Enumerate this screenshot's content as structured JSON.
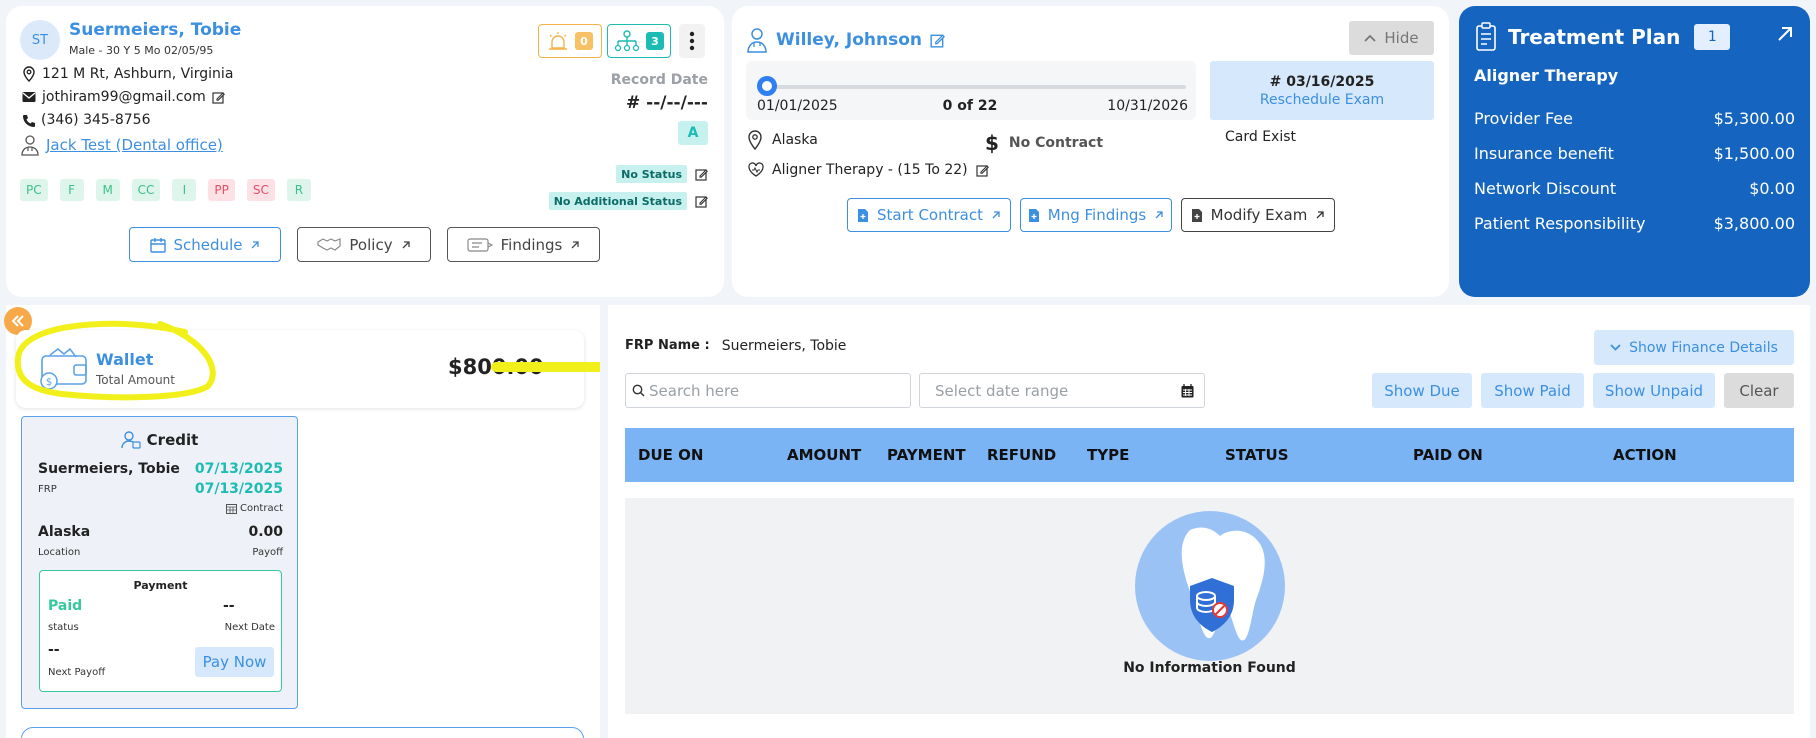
{
  "patient": {
    "initials": "ST",
    "name": "Suermeiers, Tobie",
    "meta": "Male - 30 Y 5 Mo 02/05/95",
    "address": "121 M Rt, Ashburn, Virginia",
    "email": "jothiram99@gmail.com",
    "phone": "(346) 345-8756",
    "office": "Jack Test (Dental office)",
    "tags": [
      {
        "label": "PC",
        "color": "green"
      },
      {
        "label": "F",
        "color": "green"
      },
      {
        "label": "M",
        "color": "green"
      },
      {
        "label": "CC",
        "color": "green"
      },
      {
        "label": "I",
        "color": "green"
      },
      {
        "label": "PP",
        "color": "red"
      },
      {
        "label": "SC",
        "color": "red"
      },
      {
        "label": "R",
        "color": "green"
      }
    ],
    "alert_count": "0",
    "hierarchy_count": "3",
    "record_date_label": "Record Date",
    "record_date_value": "# --/--/---",
    "grade": "A",
    "no_status": "No Status",
    "no_additional_status": "No Additional Status",
    "buttons": {
      "schedule": "Schedule",
      "policy": "Policy",
      "findings": "Findings"
    }
  },
  "doctor": {
    "name": "Willey, Johnson",
    "hide_label": "Hide",
    "start_date": "01/01/2025",
    "progress": "0 of 22",
    "progress_fraction": 0,
    "end_date": "10/31/2026",
    "exam_date": "# 03/16/2025",
    "reschedule": "Reschedule Exam",
    "location": "Alaska",
    "contract": "No Contract",
    "card": "Card Exist",
    "therapy": "Aligner Therapy - (15 To 22)",
    "buttons": {
      "start_contract": "Start Contract",
      "mng_findings": "Mng Findings",
      "modify_exam": "Modify Exam"
    }
  },
  "treatment_plan": {
    "title": "Treatment Plan",
    "count": "1",
    "subtitle": "Aligner Therapy",
    "rows": [
      {
        "label": "Provider Fee",
        "value": "$5,300.00"
      },
      {
        "label": "Insurance benefit",
        "value": "$1,500.00"
      },
      {
        "label": "Network Discount",
        "value": "$0.00"
      },
      {
        "label": "Patient Responsibility",
        "value": "$3,800.00"
      }
    ]
  },
  "wallet": {
    "title": "Wallet",
    "subtitle": "Total Amount",
    "amount": "$800.00"
  },
  "credit": {
    "title": "Credit",
    "name": "Suermeiers, Tobie",
    "date1": "07/13/2025",
    "frp": "FRP",
    "date2": "07/13/2025",
    "contract": "Contract",
    "location": "Alaska",
    "location_label": "Location",
    "payoff_value": "0.00",
    "payoff_label": "Payoff",
    "payment_title": "Payment",
    "status_value": "Paid",
    "status_label": "status",
    "next_date_value": "--",
    "next_date_label": "Next Date",
    "next_payoff_value": "--",
    "next_payoff_label": "Next Payoff",
    "pay_now": "Pay Now"
  },
  "finance": {
    "frp_label": "FRP Name :",
    "frp_value": "Suermeiers, Tobie",
    "show_details": "Show Finance Details",
    "search_placeholder": "Search here",
    "date_placeholder": "Select date range",
    "filters": {
      "due": "Show Due",
      "paid": "Show Paid",
      "unpaid": "Show Unpaid",
      "clear": "Clear"
    },
    "columns": [
      "DUE ON",
      "AMOUNT",
      "PAYMENT",
      "REFUND",
      "TYPE",
      "STATUS",
      "PAID ON",
      "ACTION"
    ],
    "empty_text": "No Information Found"
  },
  "colors": {
    "accent": "#3d8fe0",
    "plan": "#1565c0",
    "header": "#7ab4f5",
    "highlight": "#f2f01a"
  }
}
